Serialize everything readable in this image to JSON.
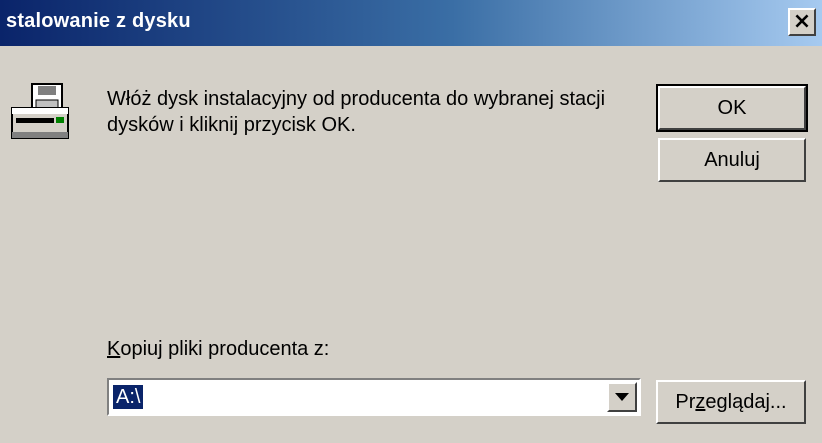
{
  "window": {
    "title": "stalowanie z dysku",
    "close_glyph": "×"
  },
  "message": "Włóż dysk instalacyjny od producenta do wybranej stacji dysków i kliknij przycisk OK.",
  "buttons": {
    "ok_label": "OK",
    "cancel_label": "Anuluj",
    "browse_label_pre": "Pr",
    "browse_label_acc": "z",
    "browse_label_post": "eglądaj..."
  },
  "copy_from": {
    "label_acc": "K",
    "label_rest": "opiuj pliki producenta z:",
    "value": "A:\\"
  },
  "icons": {
    "disk": "floppy-drive-icon",
    "dropdown": "chevron-down-icon",
    "close": "close-icon"
  },
  "colors": {
    "titlebar_start": "#0a246a",
    "titlebar_end": "#a6caf0",
    "dialog_bg": "#d4d0c8",
    "selection": "#0a246a"
  }
}
